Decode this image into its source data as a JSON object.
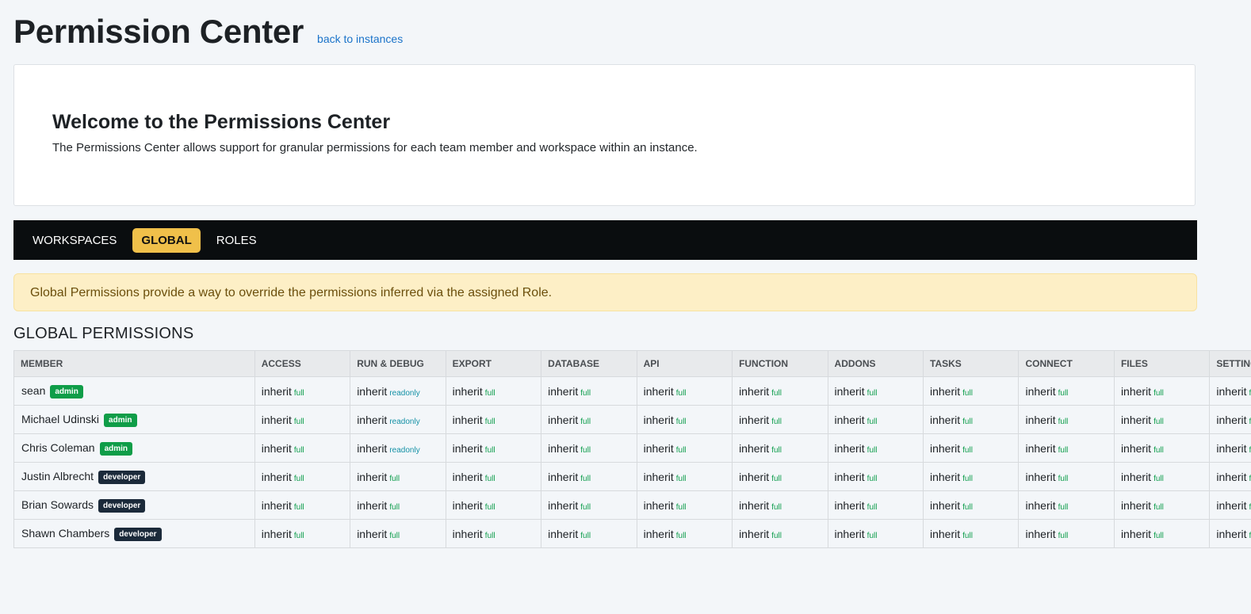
{
  "header": {
    "title": "Permission Center",
    "back_link": "back to instances"
  },
  "welcome": {
    "title": "Welcome to the Permissions Center",
    "text": "The Permissions Center allows support for granular permissions for each team member and workspace within an instance."
  },
  "tabs": [
    {
      "label": "WORKSPACES",
      "active": false
    },
    {
      "label": "GLOBAL",
      "active": true
    },
    {
      "label": "ROLES",
      "active": false
    }
  ],
  "alert": {
    "text": "Global Permissions provide a way to override the permissions inferred via the assigned Role."
  },
  "section_title": "GLOBAL PERMISSIONS",
  "table": {
    "columns": [
      "MEMBER",
      "ACCESS",
      "RUN & DEBUG",
      "EXPORT",
      "DATABASE",
      "API",
      "FUNCTION",
      "ADDONS",
      "TASKS",
      "CONNECT",
      "FILES",
      "SETTINGS"
    ],
    "rows": [
      {
        "member": "sean",
        "role": "admin",
        "cells": [
          {
            "value": "inherit",
            "level": "full"
          },
          {
            "value": "inherit",
            "level": "readonly"
          },
          {
            "value": "inherit",
            "level": "full"
          },
          {
            "value": "inherit",
            "level": "full"
          },
          {
            "value": "inherit",
            "level": "full"
          },
          {
            "value": "inherit",
            "level": "full"
          },
          {
            "value": "inherit",
            "level": "full"
          },
          {
            "value": "inherit",
            "level": "full"
          },
          {
            "value": "inherit",
            "level": "full"
          },
          {
            "value": "inherit",
            "level": "full"
          },
          {
            "value": "inherit",
            "level": "full"
          }
        ]
      },
      {
        "member": "Michael Udinski",
        "role": "admin",
        "cells": [
          {
            "value": "inherit",
            "level": "full"
          },
          {
            "value": "inherit",
            "level": "readonly"
          },
          {
            "value": "inherit",
            "level": "full"
          },
          {
            "value": "inherit",
            "level": "full"
          },
          {
            "value": "inherit",
            "level": "full"
          },
          {
            "value": "inherit",
            "level": "full"
          },
          {
            "value": "inherit",
            "level": "full"
          },
          {
            "value": "inherit",
            "level": "full"
          },
          {
            "value": "inherit",
            "level": "full"
          },
          {
            "value": "inherit",
            "level": "full"
          },
          {
            "value": "inherit",
            "level": "full"
          }
        ]
      },
      {
        "member": "Chris Coleman",
        "role": "admin",
        "cells": [
          {
            "value": "inherit",
            "level": "full"
          },
          {
            "value": "inherit",
            "level": "readonly"
          },
          {
            "value": "inherit",
            "level": "full"
          },
          {
            "value": "inherit",
            "level": "full"
          },
          {
            "value": "inherit",
            "level": "full"
          },
          {
            "value": "inherit",
            "level": "full"
          },
          {
            "value": "inherit",
            "level": "full"
          },
          {
            "value": "inherit",
            "level": "full"
          },
          {
            "value": "inherit",
            "level": "full"
          },
          {
            "value": "inherit",
            "level": "full"
          },
          {
            "value": "inherit",
            "level": "full"
          }
        ]
      },
      {
        "member": "Justin Albrecht",
        "role": "developer",
        "cells": [
          {
            "value": "inherit",
            "level": "full"
          },
          {
            "value": "inherit",
            "level": "full"
          },
          {
            "value": "inherit",
            "level": "full"
          },
          {
            "value": "inherit",
            "level": "full"
          },
          {
            "value": "inherit",
            "level": "full"
          },
          {
            "value": "inherit",
            "level": "full"
          },
          {
            "value": "inherit",
            "level": "full"
          },
          {
            "value": "inherit",
            "level": "full"
          },
          {
            "value": "inherit",
            "level": "full"
          },
          {
            "value": "inherit",
            "level": "full"
          },
          {
            "value": "inherit",
            "level": "full"
          }
        ]
      },
      {
        "member": "Brian Sowards",
        "role": "developer",
        "cells": [
          {
            "value": "inherit",
            "level": "full"
          },
          {
            "value": "inherit",
            "level": "full"
          },
          {
            "value": "inherit",
            "level": "full"
          },
          {
            "value": "inherit",
            "level": "full"
          },
          {
            "value": "inherit",
            "level": "full"
          },
          {
            "value": "inherit",
            "level": "full"
          },
          {
            "value": "inherit",
            "level": "full"
          },
          {
            "value": "inherit",
            "level": "full"
          },
          {
            "value": "inherit",
            "level": "full"
          },
          {
            "value": "inherit",
            "level": "full"
          },
          {
            "value": "inherit",
            "level": "full"
          }
        ]
      },
      {
        "member": "Shawn Chambers",
        "role": "developer",
        "cells": [
          {
            "value": "inherit",
            "level": "full"
          },
          {
            "value": "inherit",
            "level": "full"
          },
          {
            "value": "inherit",
            "level": "full"
          },
          {
            "value": "inherit",
            "level": "full"
          },
          {
            "value": "inherit",
            "level": "full"
          },
          {
            "value": "inherit",
            "level": "full"
          },
          {
            "value": "inherit",
            "level": "full"
          },
          {
            "value": "inherit",
            "level": "full"
          },
          {
            "value": "inherit",
            "level": "full"
          },
          {
            "value": "inherit",
            "level": "full"
          },
          {
            "value": "inherit",
            "level": "full"
          }
        ]
      }
    ]
  },
  "colors": {
    "tab_active": "#f0c04a",
    "badge_admin": "#0f9d48",
    "badge_developer": "#1b2a3a",
    "level_full": "#0b9c4a",
    "level_readonly": "#1591a6",
    "link": "#1a73c9"
  }
}
